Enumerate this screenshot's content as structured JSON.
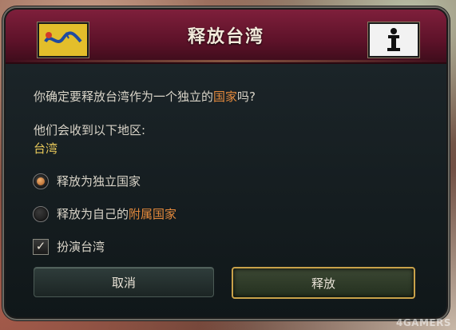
{
  "dialog": {
    "title": "释放台湾",
    "question_prefix": "你确定要释放台湾作为一个独立的",
    "question_highlight": "国家",
    "question_suffix": "吗?",
    "receive_label": "他们会收到以下地区:",
    "region_name": "台湾",
    "options": [
      {
        "label_prefix": "释放为独立国家",
        "label_highlight": "",
        "selected": true
      },
      {
        "label_prefix": "释放为自己的",
        "label_highlight": "附属国家",
        "selected": false
      }
    ],
    "play_as": {
      "label": "扮演台湾",
      "checked": true
    },
    "buttons": {
      "cancel": "取消",
      "release": "释放"
    }
  },
  "watermark": "4GAMERS",
  "colors": {
    "accent_orange": "#e58a3c",
    "region_yellow": "#e7c85a",
    "header": "#6a1732"
  },
  "icons": {
    "left_flag": "qing-dragon-flag-icon",
    "right_flag": "taiwan-flag-icon"
  }
}
